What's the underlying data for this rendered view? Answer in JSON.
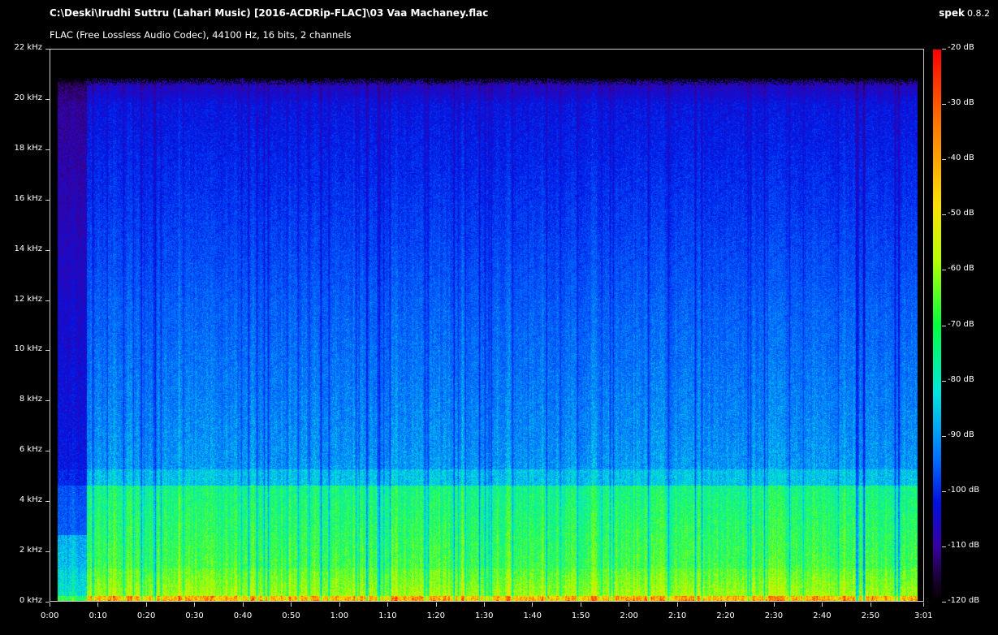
{
  "header": {
    "file_path": "C:\\Deski\\Irudhi Suttru (Lahari Music) [2016-ACDRip-FLAC]\\03 Vaa Machaney.flac",
    "format_info": "FLAC (Free Lossless Audio Codec), 44100 Hz, 16 bits, 2 channels",
    "app_name": "spek",
    "app_version": "0.8.2"
  },
  "axes": {
    "frequency_labels": [
      "22 kHz",
      "20 kHz",
      "18 kHz",
      "16 kHz",
      "14 kHz",
      "12 kHz",
      "10 kHz",
      "8 kHz",
      "6 kHz",
      "4 kHz",
      "2 kHz",
      "0 kHz"
    ],
    "time_labels": [
      "0:00",
      "0:10",
      "0:20",
      "0:30",
      "0:40",
      "0:50",
      "1:00",
      "1:10",
      "1:20",
      "1:30",
      "1:40",
      "1:50",
      "2:00",
      "2:10",
      "2:20",
      "2:30",
      "2:40",
      "2:50",
      "3:01"
    ],
    "db_labels": [
      "-20 dB",
      "-30 dB",
      "-40 dB",
      "-50 dB",
      "-60 dB",
      "-70 dB",
      "-80 dB",
      "-90 dB",
      "-100 dB",
      "-110 dB",
      "-120 dB"
    ]
  },
  "colors": {
    "background": "#000000",
    "axis": "#cfcfcf"
  }
}
